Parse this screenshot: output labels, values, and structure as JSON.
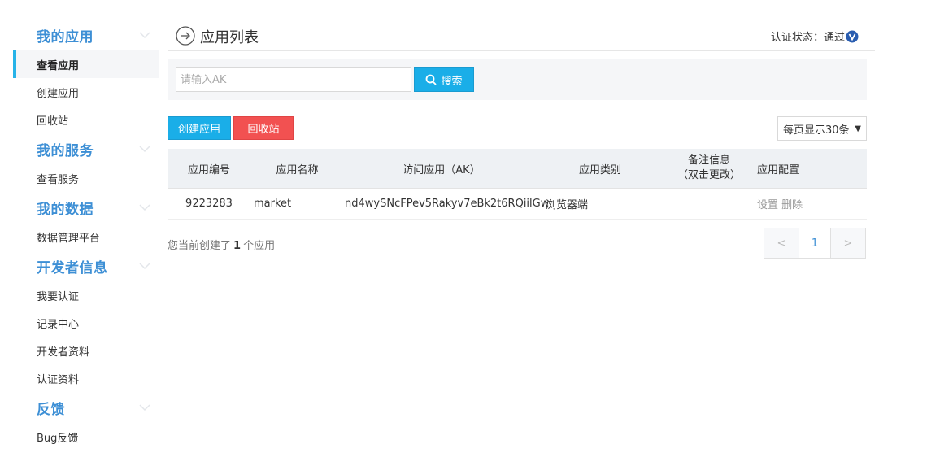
{
  "sidebar": {
    "sections": [
      {
        "title": "我的应用",
        "items": [
          "查看应用",
          "创建应用",
          "回收站"
        ]
      },
      {
        "title": "我的服务",
        "items": [
          "查看服务"
        ]
      },
      {
        "title": "我的数据",
        "items": [
          "数据管理平台"
        ]
      },
      {
        "title": "开发者信息",
        "items": [
          "我要认证",
          "记录中心",
          "开发者资料",
          "认证资料"
        ]
      },
      {
        "title": "反馈",
        "items": [
          "Bug反馈"
        ]
      }
    ],
    "active_item": "查看应用"
  },
  "header": {
    "title": "应用列表",
    "auth_label": "认证状态：",
    "auth_value": "通过"
  },
  "search": {
    "placeholder": "请输入AK",
    "value": "",
    "button_label": "搜索"
  },
  "actions": {
    "create_label": "创建应用",
    "recycle_label": "回收站",
    "page_size_label": "每页显示30条"
  },
  "table": {
    "headers": {
      "id": "应用编号",
      "name": "应用名称",
      "ak": "访问应用（AK）",
      "type": "应用类别",
      "remark_line1": "备注信息",
      "remark_line2": "（双击更改）",
      "config": "应用配置"
    },
    "rows": [
      {
        "id": "9223283",
        "name": "market",
        "ak": "nd4wySNcFPev5Rakyv7eBk2t6RQiilGw",
        "type": "浏览器端",
        "remark": "",
        "op_settings": "设置",
        "op_delete": "删除"
      }
    ]
  },
  "footer": {
    "count_prefix": "您当前创建了",
    "count": "1",
    "count_suffix": "个应用",
    "pager": {
      "prev": "<",
      "current": "1",
      "next": ">"
    }
  },
  "colors": {
    "accent": "#1aaee8",
    "danger": "#f25151",
    "section_title": "#3d8fd5",
    "verified_badge": "#2a5db0"
  }
}
